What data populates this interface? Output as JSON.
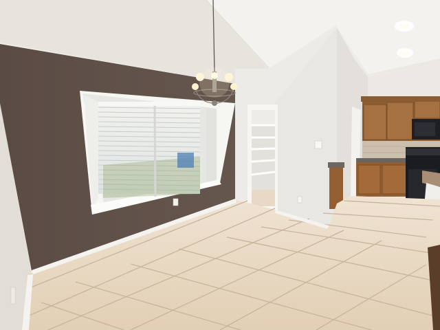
{
  "scene": {
    "subject": "interior",
    "colors": {
      "accent_wall": "#5f5048",
      "wall": "#e9e5df",
      "ceiling": "#f1eee9",
      "floor_tile": "#e6d4bd",
      "grout": "#c9b69e",
      "cabinet": "#9a6a3a",
      "window_frame": "#fbfbf9",
      "baseboard": "#f7f6f2",
      "light": "#fff6d8"
    },
    "icons": [
      "chandelier-icon",
      "recessed-light-icon",
      "outlet-icon",
      "light-switch-icon"
    ]
  }
}
